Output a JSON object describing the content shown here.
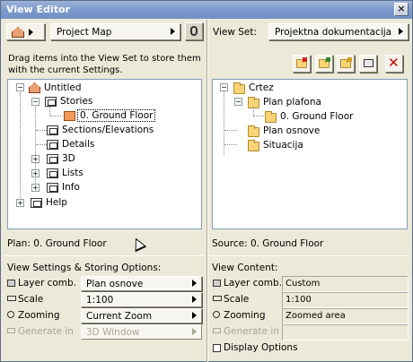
{
  "window": {
    "title": "View Editor",
    "close_glyph": "×"
  },
  "left": {
    "project_map_label": "Project Map",
    "instructions": "Drag items into the View Set to store them with the current Settings.",
    "tree": {
      "root": "Untitled",
      "stories": "Stories",
      "ground_floor": "0. Ground Floor",
      "sections": "Sections/Elevations",
      "details": "Details",
      "three_d": "3D",
      "lists": "Lists",
      "info": "Info",
      "help": "Help"
    },
    "plan_status": "Plan: 0. Ground Floor",
    "settings_header": "View Settings & Storing Options:",
    "rows": {
      "layer_label": "Layer comb.",
      "layer_value": "Plan osnove",
      "scale_label": "Scale",
      "scale_value": "1:100",
      "zooming_label": "Zooming",
      "zooming_value": "Current Zoom",
      "generate_label": "Generate in",
      "generate_value": "3D Window"
    }
  },
  "right": {
    "view_set_label": "View Set:",
    "view_set_value": "Projektna dokumentacija",
    "tree": {
      "root": "Crtez",
      "plan_plafona": "Plan plafona",
      "ground_floor": "0. Ground Floor",
      "plan_osnove": "Plan osnove",
      "situacija": "Situacija"
    },
    "source_status": "Source: 0. Ground Floor",
    "content_header": "View Content:",
    "rows": {
      "layer_label": "Layer comb.",
      "layer_value": "Custom",
      "scale_label": "Scale",
      "scale_value": "1:100",
      "zooming_label": "Zooming",
      "zooming_value": "Zoomed area",
      "generate_label": "Generate in",
      "generate_value": ""
    },
    "display_options": "Display Options"
  },
  "colors": {
    "titlebar": "#7d99cc",
    "delete_x": "#cc0000",
    "window_bg": "#ece9d8"
  },
  "icons": [
    "project-map-icon",
    "chain-link-icon",
    "new-folder-icon",
    "clone-folder-icon",
    "new-view-icon",
    "view-settings-icon",
    "delete-icon"
  ]
}
